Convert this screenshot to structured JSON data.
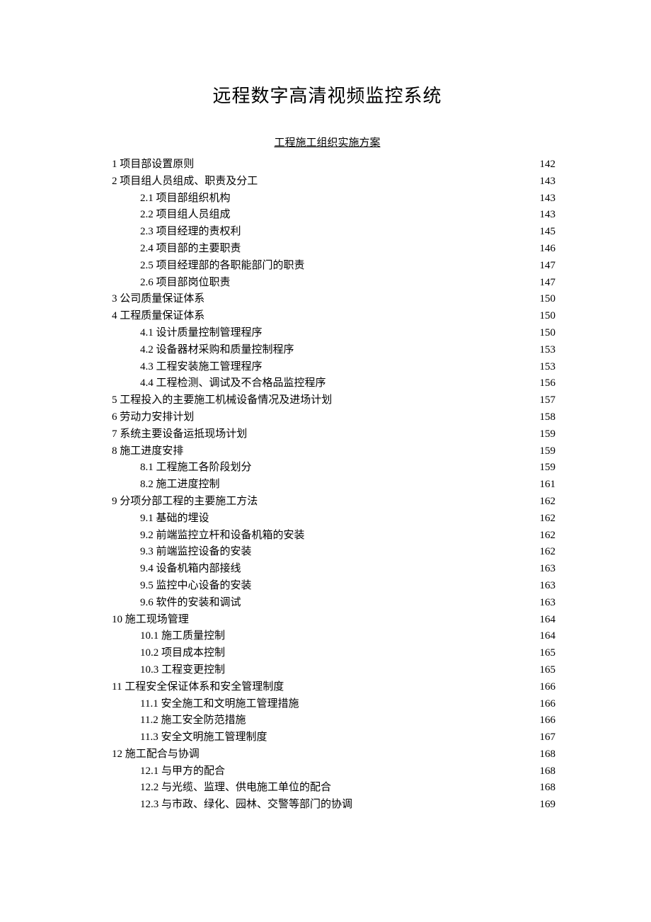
{
  "title": "远程数字高清视频监控系统",
  "subtitle": "工程施工组织实施方案",
  "toc": [
    {
      "level": 1,
      "label": "1 项目部设置原则",
      "page": "142"
    },
    {
      "level": 1,
      "label": "2 项目组人员组成、职责及分工",
      "page": "143"
    },
    {
      "level": 2,
      "label": "2.1 项目部组织机构",
      "page": "143"
    },
    {
      "level": 2,
      "label": "2.2 项目组人员组成",
      "page": "143"
    },
    {
      "level": 2,
      "label": "2.3 项目经理的责权利",
      "page": "145"
    },
    {
      "level": 2,
      "label": "2.4 项目部的主要职责",
      "page": "146"
    },
    {
      "level": 2,
      "label": "2.5 项目经理部的各职能部门的职责",
      "page": "147"
    },
    {
      "level": 2,
      "label": "2.6 项目部岗位职责",
      "page": "147"
    },
    {
      "level": 1,
      "label": "3 公司质量保证体系",
      "page": "150"
    },
    {
      "level": 1,
      "label": "4  工程质量保证体系",
      "page": "150"
    },
    {
      "level": 2,
      "label": "4.1 设计质量控制管理程序",
      "page": "150"
    },
    {
      "level": 2,
      "label": "4.2 设备器材采购和质量控制程序",
      "page": "153"
    },
    {
      "level": 2,
      "label": "4.3 工程安装施工管理程序",
      "page": "153"
    },
    {
      "level": 2,
      "label": "4.4 工程检测、调试及不合格品监控程序",
      "page": "156"
    },
    {
      "level": 1,
      "label": "5  工程投入的主要施工机械设备情况及进场计划",
      "page": "157"
    },
    {
      "level": 1,
      "label": "6 劳动力安排计划",
      "page": "158"
    },
    {
      "level": 1,
      "label": "7  系统主要设备运抵现场计划",
      "page": "159"
    },
    {
      "level": 1,
      "label": "8  施工进度安排",
      "page": "159"
    },
    {
      "level": 2,
      "label": "8.1 工程施工各阶段划分",
      "page": "159"
    },
    {
      "level": 2,
      "label": "8.2 施工进度控制",
      "page": "161"
    },
    {
      "level": 1,
      "label": "9 分项分部工程的主要施工方法",
      "page": "162"
    },
    {
      "level": 2,
      "label": "9.1 基础的埋设",
      "page": "162"
    },
    {
      "level": 2,
      "label": "9.2 前端监控立杆和设备机箱的安装",
      "page": "162"
    },
    {
      "level": 2,
      "label": "9.3 前端监控设备的安装",
      "page": "162"
    },
    {
      "level": 2,
      "label": "9.4 设备机箱内部接线",
      "page": "163"
    },
    {
      "level": 2,
      "label": "9.5 监控中心设备的安装",
      "page": "163"
    },
    {
      "level": 2,
      "label": "9.6 软件的安装和调试",
      "page": "163"
    },
    {
      "level": 1,
      "label": "10  施工现场管理",
      "page": "164"
    },
    {
      "level": 2,
      "label": "10.1 施工质量控制",
      "page": "164"
    },
    {
      "level": 2,
      "label": "10.2 项目成本控制",
      "page": "165"
    },
    {
      "level": 2,
      "label": "10.3 工程变更控制",
      "page": "165"
    },
    {
      "level": 1,
      "label": "11  工程安全保证体系和安全管理制度",
      "page": "166"
    },
    {
      "level": 2,
      "label": "11.1 安全施工和文明施工管理措施",
      "page": "166"
    },
    {
      "level": 2,
      "label": "11.2 施工安全防范措施",
      "page": "166"
    },
    {
      "level": 2,
      "label": "11.3 安全文明施工管理制度",
      "page": "167"
    },
    {
      "level": 1,
      "label": "12 施工配合与协调",
      "page": "168"
    },
    {
      "level": 2,
      "label": "12.1 与甲方的配合",
      "page": "168"
    },
    {
      "level": 2,
      "label": "12.2 与光缆、监理、供电施工单位的配合",
      "page": "168"
    },
    {
      "level": 2,
      "label": "12.3 与市政、绿化、园林、交警等部门的协调",
      "page": "169"
    }
  ]
}
